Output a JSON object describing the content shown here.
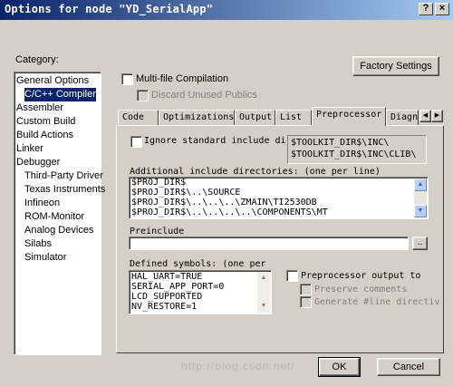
{
  "window": {
    "title": "Options for node \"YD_SerialApp\""
  },
  "category": {
    "label": "Category:",
    "items": [
      {
        "label": "General Options",
        "indent": false,
        "selected": false
      },
      {
        "label": "C/C++ Compiler",
        "indent": true,
        "selected": true
      },
      {
        "label": "Assembler",
        "indent": false,
        "selected": false
      },
      {
        "label": "Custom Build",
        "indent": false,
        "selected": false
      },
      {
        "label": "Build Actions",
        "indent": false,
        "selected": false
      },
      {
        "label": "Linker",
        "indent": false,
        "selected": false
      },
      {
        "label": "Debugger",
        "indent": false,
        "selected": false
      },
      {
        "label": "Third-Party Driver",
        "indent": true,
        "selected": false
      },
      {
        "label": "Texas Instruments",
        "indent": true,
        "selected": false
      },
      {
        "label": "Infineon",
        "indent": true,
        "selected": false
      },
      {
        "label": "ROM-Monitor",
        "indent": true,
        "selected": false
      },
      {
        "label": "Analog Devices",
        "indent": true,
        "selected": false
      },
      {
        "label": "Silabs",
        "indent": true,
        "selected": false
      },
      {
        "label": "Simulator",
        "indent": true,
        "selected": false
      }
    ]
  },
  "factory_settings_label": "Factory Settings",
  "multifile_label": "Multi-file Compilation",
  "discard_label": "Discard Unused Publics",
  "tabs": [
    "Code",
    "Optimizations",
    "Output",
    "List",
    "Preprocessor",
    "Diagn"
  ],
  "active_tab": "Preprocessor",
  "ignore_std_label": "Ignore standard include dire",
  "toolkit_paths": [
    "$TOOLKIT_DIR$\\INC\\",
    "$TOOLKIT_DIR$\\INC\\CLIB\\"
  ],
  "additional_label": "Additional include directories: (one per line)",
  "include_dirs": [
    "$PROJ_DIR$",
    "$PROJ_DIR$\\..\\SOURCE",
    "$PROJ_DIR$\\..\\..\\..\\ZMAIN\\TI2530DB",
    "$PROJ_DIR$\\..\\..\\..\\..\\COMPONENTS\\MT"
  ],
  "preinclude_label": "Preinclude",
  "preinclude_value": "",
  "browse_label": "..",
  "defined_label": "Defined symbols: (one per",
  "defined_symbols": [
    "HAL_UART=TRUE",
    "SERIAL_APP_PORT=0",
    "LCD_SUPPORTED",
    "NV_RESTORE=1"
  ],
  "pp_output_label": "Preprocessor output to",
  "preserve_label": "Preserve comments",
  "generate_label": "Generate #line directiv",
  "ok_label": "OK",
  "cancel_label": "Cancel",
  "watermark": "http://blog.csdn.net/"
}
